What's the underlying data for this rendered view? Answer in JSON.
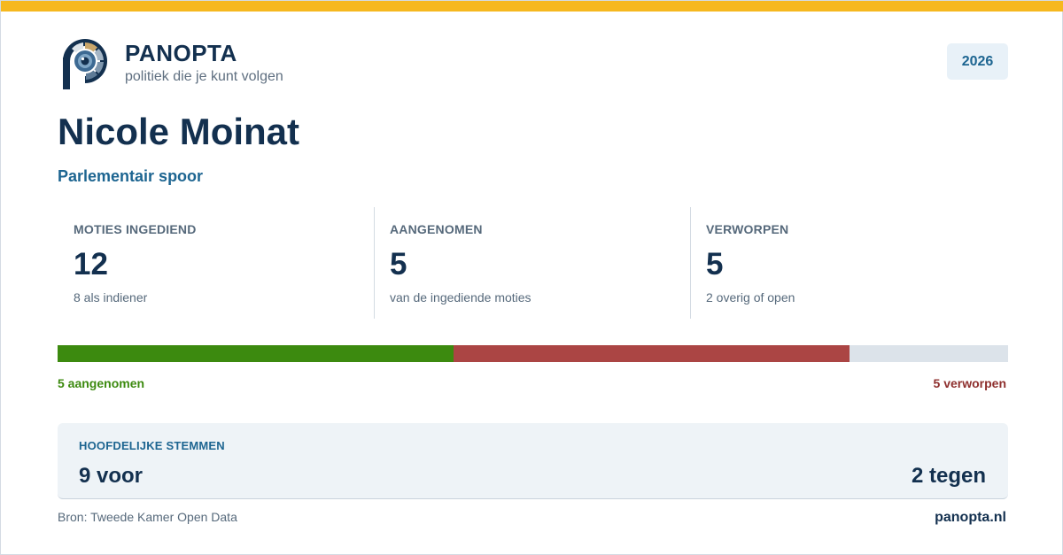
{
  "brand": {
    "name": "PANOPTA",
    "tagline": "politiek die je kunt volgen",
    "colors": {
      "navy": "#13304f",
      "accent": "#f6b81f",
      "blue": "#1d6591"
    }
  },
  "year": "2026",
  "person": {
    "name": "Nicole Moinat",
    "subtitle": "Parlementair spoor"
  },
  "stats": [
    {
      "label": "MOTIES INGEDIEND",
      "value": "12",
      "sub": "8 als indiener"
    },
    {
      "label": "AANGENOMEN",
      "value": "5",
      "sub": "van de ingediende moties"
    },
    {
      "label": "VERWORPEN",
      "value": "5",
      "sub": "2 overig of open"
    }
  ],
  "outcome_bar": {
    "total": 12,
    "adopted": 5,
    "rejected": 5,
    "other": 2,
    "adopted_label": "5 aangenomen",
    "rejected_label": "5 verworpen",
    "colors": {
      "adopted": "#3c8a0f",
      "rejected": "#ab4544",
      "other": "#dce3ea"
    }
  },
  "votes": {
    "label": "HOOFDELIJKE STEMMEN",
    "for": "9 voor",
    "against": "2 tegen"
  },
  "footer": {
    "source": "Bron: Tweede Kamer Open Data",
    "site": "panopta.nl"
  }
}
